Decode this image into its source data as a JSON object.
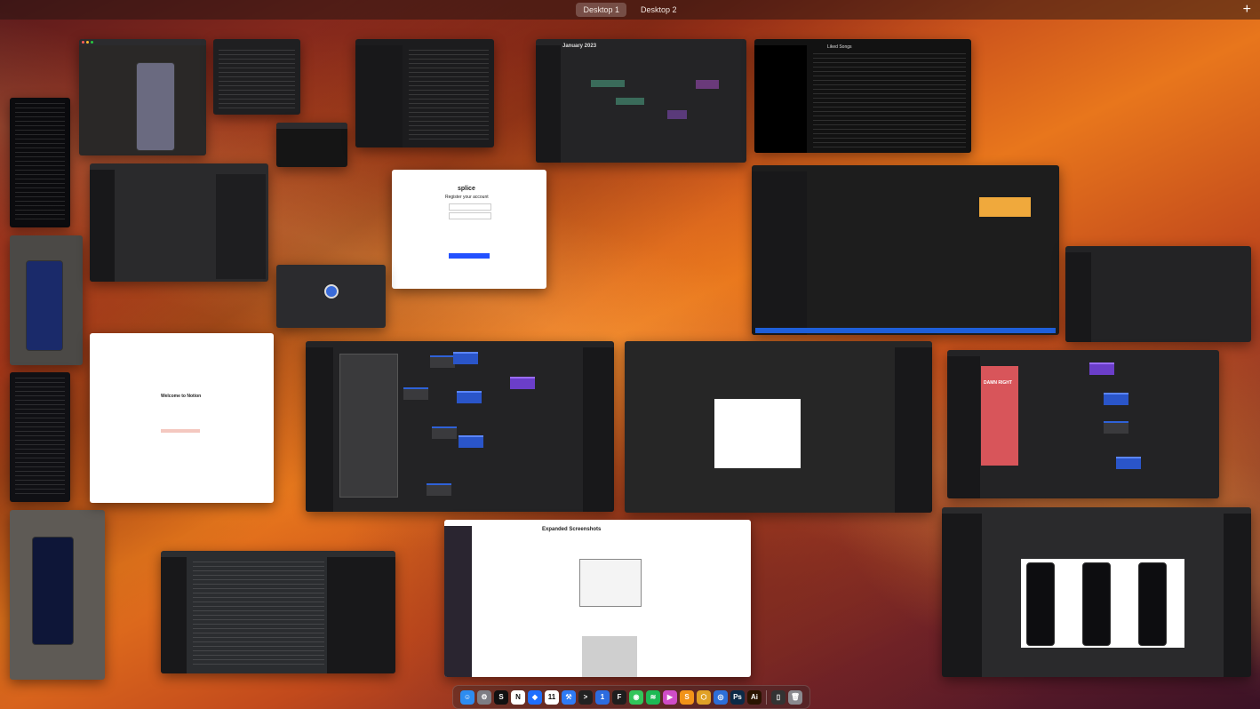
{
  "spaces": {
    "items": [
      "Desktop 1",
      "Desktop 2"
    ],
    "add_label": "+"
  },
  "windows": {
    "calendar_title": "January 2023",
    "music_playlist": "Liked Songs",
    "splice_brand": "splice",
    "splice_prompt": "Register your account",
    "notion_title": "Welcome to Notion",
    "figma_banner": "DAMN RIGHT",
    "doc_title": "Expanded Screenshots"
  },
  "dock": {
    "icons": [
      {
        "name": "finder-icon",
        "color": "#2d8cf0",
        "glyph": "☺"
      },
      {
        "name": "system-preferences-icon",
        "color": "#7d7d84",
        "glyph": "⚙"
      },
      {
        "name": "splice-icon",
        "color": "#111111",
        "glyph": "S"
      },
      {
        "name": "notion-icon",
        "color": "#ffffff",
        "glyph": "N"
      },
      {
        "name": "dropbox-icon",
        "color": "#1f6fff",
        "glyph": "◆"
      },
      {
        "name": "calendar-icon",
        "color": "#ffffff",
        "glyph": "11"
      },
      {
        "name": "xcode-icon",
        "color": "#2f7bf5",
        "glyph": "⚒"
      },
      {
        "name": "terminal-icon",
        "color": "#222222",
        "glyph": ">"
      },
      {
        "name": "1password-icon",
        "color": "#2d6cdf",
        "glyph": "1"
      },
      {
        "name": "figma-icon",
        "color": "#1e1e1e",
        "glyph": "F"
      },
      {
        "name": "messages-icon",
        "color": "#32c55a",
        "glyph": "◉"
      },
      {
        "name": "spotify-icon",
        "color": "#1db954",
        "glyph": "≋"
      },
      {
        "name": "screen-recorder-icon",
        "color": "#d04cc7",
        "glyph": "▶"
      },
      {
        "name": "sublime-text-icon",
        "color": "#f29318",
        "glyph": "S"
      },
      {
        "name": "transmit-icon",
        "color": "#e0a126",
        "glyph": "⬡"
      },
      {
        "name": "proxyman-icon",
        "color": "#2d6fd9",
        "glyph": "◎"
      },
      {
        "name": "photoshop-icon",
        "color": "#0c2a47",
        "glyph": "Ps"
      },
      {
        "name": "illustrator-icon",
        "color": "#2a1400",
        "glyph": "Ai"
      }
    ],
    "trailing": [
      {
        "name": "iphone-mirroring-icon",
        "color": "#333333",
        "glyph": "▯"
      },
      {
        "name": "trash-icon",
        "color": "#8a8a8f",
        "glyph": "🗑"
      }
    ]
  }
}
